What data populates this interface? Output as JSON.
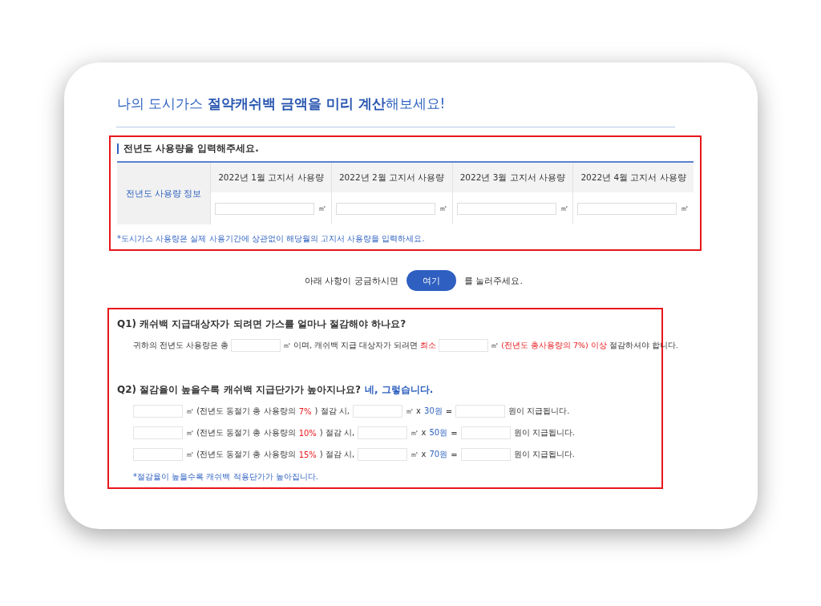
{
  "title": "나의 도시가스 **절약캐쉬백 금액을 미리 계산**해보세요!",
  "usage_section": {
    "heading": "전년도 사용량을 입력해주세요.",
    "row_header": "전년도 사용량 정보",
    "columns": [
      {
        "label": "2022년 1월 고지서 사용량",
        "unit": "㎥"
      },
      {
        "label": "2022년 2월 고지서 사용량",
        "unit": "㎥"
      },
      {
        "label": "2022년 3월 고지서 사용량",
        "unit": "㎥"
      },
      {
        "label": "2022년 4월 고지서 사용량",
        "unit": "㎥"
      }
    ],
    "note": "*도시가스 사용량은 실제 사용기간에 상관없이 해당월의 고지서 사용량을 입력하세요."
  },
  "help_line": {
    "before": "아래 사항이 궁금하시면",
    "button": "여기",
    "after": "를 눌러주세요."
  },
  "faq": {
    "q1": {
      "question": "Q1) 캐쉬백 지급대상자가 되려면 가스를 얼마나 절감해야 하나요?",
      "parts": [
        {
          "kind": "text",
          "text": "귀하의 전년도 사용량은 총"
        },
        {
          "kind": "field"
        },
        {
          "kind": "text",
          "text": "㎥ 이며, 캐쉬백 지급 대상자가 되려면"
        },
        {
          "kind": "accent",
          "text": "최소"
        },
        {
          "kind": "field"
        },
        {
          "kind": "text",
          "text": "㎥"
        },
        {
          "kind": "accent",
          "text": "(전년도 총사용량의 7%) 이상"
        },
        {
          "kind": "text",
          "text": "절감하셔야 합니다."
        }
      ]
    },
    "q2": {
      "question": "Q2) 절감율이 높을수록 캐쉬백 지급단가가 높아지나요?",
      "answer": "네, 그렇습니다.",
      "rows": [
        {
          "parts": [
            {
              "kind": "field"
            },
            {
              "kind": "text",
              "text": "㎥ (전년도 동절기 총 사용량의"
            },
            {
              "kind": "accent",
              "text": "7%"
            },
            {
              "kind": "text",
              "text": ") 절감 시,"
            },
            {
              "kind": "field"
            },
            {
              "kind": "text",
              "text": "㎥ x"
            },
            {
              "kind": "link",
              "text": "30원"
            },
            {
              "kind": "text",
              "text": "="
            },
            {
              "kind": "field"
            },
            {
              "kind": "text",
              "text": "원이 지급됩니다."
            }
          ]
        },
        {
          "parts": [
            {
              "kind": "field"
            },
            {
              "kind": "text",
              "text": "㎥ (전년도 동절기 총 사용량의"
            },
            {
              "kind": "accent",
              "text": "10%"
            },
            {
              "kind": "text",
              "text": ") 절감 시,"
            },
            {
              "kind": "field"
            },
            {
              "kind": "text",
              "text": "㎥ x"
            },
            {
              "kind": "link",
              "text": "50원"
            },
            {
              "kind": "text",
              "text": "="
            },
            {
              "kind": "field"
            },
            {
              "kind": "text",
              "text": "원이 지급됩니다."
            }
          ]
        },
        {
          "parts": [
            {
              "kind": "field"
            },
            {
              "kind": "text",
              "text": "㎥ (전년도 동절기 총 사용량의"
            },
            {
              "kind": "accent",
              "text": "15%"
            },
            {
              "kind": "text",
              "text": ") 절감 시,"
            },
            {
              "kind": "field"
            },
            {
              "kind": "text",
              "text": "㎥ x"
            },
            {
              "kind": "link",
              "text": "70원"
            },
            {
              "kind": "text",
              "text": "="
            },
            {
              "kind": "field"
            },
            {
              "kind": "text",
              "text": "원이 지급됩니다."
            }
          ]
        }
      ],
      "note": "*절감율이 높을수록 캐쉬백 적용단가가 높아집니다."
    }
  }
}
